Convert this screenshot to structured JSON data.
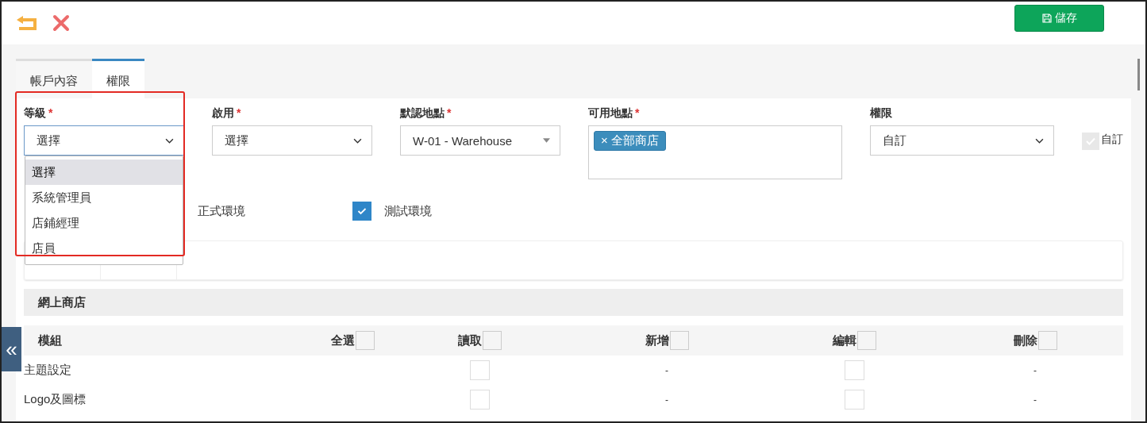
{
  "toolbar": {
    "save_label": "儲存"
  },
  "tabs": [
    {
      "label": "帳戶內容",
      "selected": false
    },
    {
      "label": "權限",
      "selected": true
    }
  ],
  "fields": [
    {
      "kind": "select",
      "label": "等級",
      "required_mark": "*",
      "value": "選擇",
      "expanded": true,
      "options": [
        {
          "label": "選擇",
          "selected": true
        },
        {
          "label": "系統管理員",
          "selected": false
        },
        {
          "label": "店鋪經理",
          "selected": false
        },
        {
          "label": "店員",
          "selected": false
        }
      ]
    },
    {
      "kind": "select",
      "label": "啟用",
      "required_mark": "*",
      "value": "選擇",
      "expanded": false
    },
    {
      "kind": "combo",
      "label": "默認地點",
      "required_mark": "*",
      "value": "W-01 - Warehouse",
      "expanded": false
    },
    {
      "kind": "tags",
      "label": "可用地點",
      "required_mark": "*",
      "tags": [
        {
          "remove": "×",
          "label": "全部商店"
        }
      ],
      "expanded": false
    },
    {
      "kind": "select",
      "label": "權限",
      "value": "自訂",
      "expanded": false
    }
  ],
  "custom": {
    "label": "自訂",
    "checked": true,
    "disabled": true
  },
  "production_label": "正式環境",
  "test_environment": {
    "label": "測試環境",
    "checked": true
  },
  "section_title": "網上商店",
  "columns": [
    {
      "label": "模組"
    },
    {
      "label": "全選",
      "checked": false
    },
    {
      "label": "讀取",
      "checked": false
    },
    {
      "label": "新增",
      "checked": false
    },
    {
      "label": "編輯",
      "checked": false
    },
    {
      "label": "刪除",
      "checked": false
    }
  ],
  "rows": [
    {
      "module": "主題設定",
      "cells": [
        {
          "kind": "none"
        },
        {
          "kind": "checkbox",
          "checked": false
        },
        {
          "kind": "dash",
          "text": "-"
        },
        {
          "kind": "checkbox",
          "checked": false
        },
        {
          "kind": "dash",
          "text": "-"
        }
      ]
    },
    {
      "module": "Logo及圖標",
      "cells": [
        {
          "kind": "none"
        },
        {
          "kind": "checkbox",
          "checked": false
        },
        {
          "kind": "dash",
          "text": "-"
        },
        {
          "kind": "checkbox",
          "checked": false
        },
        {
          "kind": "dash",
          "text": "-"
        }
      ]
    }
  ],
  "collapse_glyph": "«"
}
